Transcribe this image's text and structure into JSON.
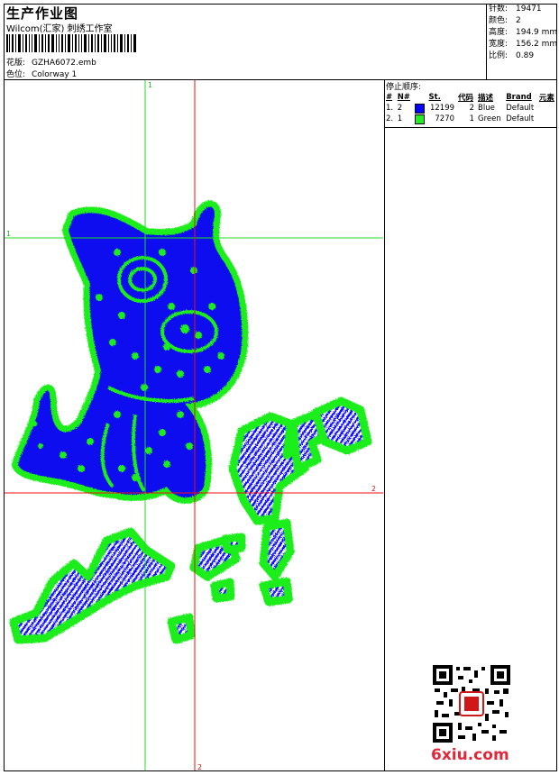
{
  "header": {
    "title": "生产作业图",
    "studio": "Wilcom(汇家) 刺绣工作室",
    "design_label": "花版:",
    "design_file": "GZHA6072.emb",
    "colorway_label": "色位:",
    "colorway": "Colorway 1"
  },
  "stats": [
    {
      "label": "针数:",
      "value": "19471"
    },
    {
      "label": "颜色:",
      "value": "2"
    },
    {
      "label": "高度:",
      "value": "194.9 mm"
    },
    {
      "label": "宽度:",
      "value": "156.2 mm"
    },
    {
      "label": "比例:",
      "value": "0.89"
    }
  ],
  "sequence": {
    "heading": "停止顺序:",
    "columns": [
      "#",
      "N#",
      "St.",
      "代码",
      "描述",
      "Brand",
      "元素"
    ],
    "rows": [
      {
        "idx": "1.",
        "n": "2",
        "color": "#0000ff",
        "st": "12199",
        "code": "2",
        "desc": "Blue",
        "brand": "Default"
      },
      {
        "idx": "2.",
        "n": "1",
        "color": "#22ee22",
        "st": "7270",
        "code": "1",
        "desc": "Green",
        "brand": "Default"
      }
    ]
  },
  "guides": {
    "h1": "1",
    "v1": "1",
    "h2": "2",
    "v2": "2"
  },
  "watermark": "6xiu.com"
}
